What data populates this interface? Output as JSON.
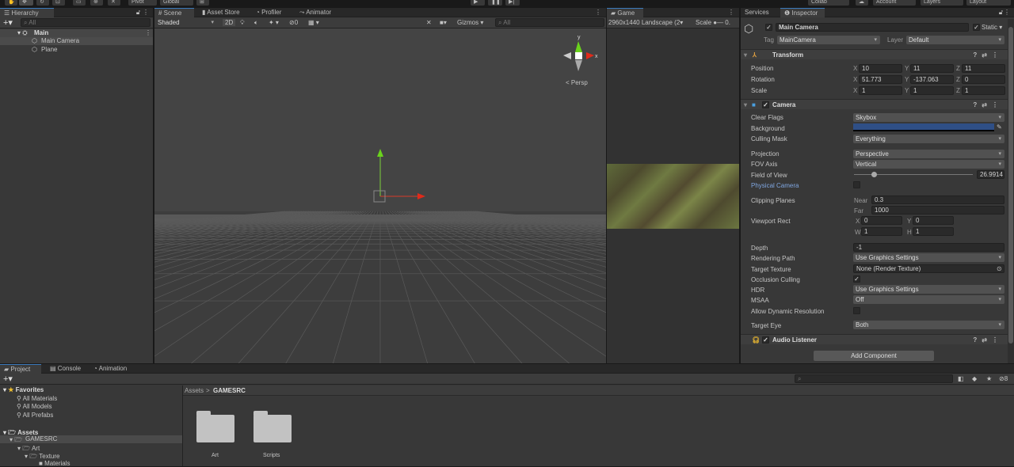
{
  "toolbar": {
    "pivot": "Pivot",
    "global": "Global",
    "collab": "Collab",
    "account": "Account",
    "layers": "Layers",
    "layout": "Layout"
  },
  "hierarchy": {
    "tab": "Hierarchy",
    "search_placeholder": "All",
    "scene": "Main",
    "items": [
      "Main Camera",
      "Plane"
    ]
  },
  "scene": {
    "tabs": [
      "Scene",
      "Asset Store",
      "Profiler",
      "Animator"
    ],
    "shading": "Shaded",
    "mode_2d": "2D",
    "hidden_count": "0",
    "gizmos": "Gizmos",
    "search_placeholder": "All",
    "persp": "< Persp"
  },
  "game": {
    "tab": "Game",
    "resolution": "2960x1440 Landscape (2",
    "scale_label": "Scale",
    "scale_value": "0."
  },
  "inspector": {
    "tabs": [
      "Services",
      "Inspector"
    ],
    "object_name": "Main Camera",
    "static_label": "Static",
    "tag_label": "Tag",
    "tag": "MainCamera",
    "layer_label": "Layer",
    "layer": "Default",
    "transform": {
      "title": "Transform",
      "rows": [
        {
          "label": "Position",
          "x": "10",
          "y": "11",
          "z": "11"
        },
        {
          "label": "Rotation",
          "x": "51.773",
          "y": "-137.063",
          "z": "0"
        },
        {
          "label": "Scale",
          "x": "1",
          "y": "1",
          "z": "1"
        }
      ]
    },
    "camera": {
      "title": "Camera",
      "clear_flags_label": "Clear Flags",
      "clear_flags": "Skybox",
      "background_label": "Background",
      "background_color": "#2f4f86",
      "culling_mask_label": "Culling Mask",
      "culling_mask": "Everything",
      "projection_label": "Projection",
      "projection": "Perspective",
      "fov_axis_label": "FOV Axis",
      "fov_axis": "Vertical",
      "fov_label": "Field of View",
      "fov": "26.9914",
      "physical_label": "Physical Camera",
      "clipping_label": "Clipping Planes",
      "near_label": "Near",
      "near": "0.3",
      "far_label": "Far",
      "far": "1000",
      "viewport_label": "Viewport Rect",
      "vx": "0",
      "vy": "0",
      "vw": "1",
      "vh": "1",
      "depth_label": "Depth",
      "depth": "-1",
      "rendering_path_label": "Rendering Path",
      "rendering_path": "Use Graphics Settings",
      "target_texture_label": "Target Texture",
      "target_texture": "None (Render Texture)",
      "occlusion_label": "Occlusion Culling",
      "hdr_label": "HDR",
      "hdr": "Use Graphics Settings",
      "msaa_label": "MSAA",
      "msaa": "Off",
      "dynres_label": "Allow Dynamic Resolution",
      "target_eye_label": "Target Eye",
      "target_eye": "Both"
    },
    "audio_listener": {
      "title": "Audio Listener"
    },
    "add_component": "Add Component"
  },
  "project": {
    "tabs": [
      "Project",
      "Console",
      "Animation"
    ],
    "favorites": "Favorites",
    "fav_items": [
      "All Materials",
      "All Models",
      "All Prefabs"
    ],
    "assets": "Assets",
    "tree": [
      "GAMESRC",
      "Art",
      "Texture",
      "Materials"
    ],
    "breadcrumb_root": "Assets",
    "breadcrumb_current": "GAMESRC",
    "folders": [
      "Art",
      "Scripts"
    ],
    "hidden_count": "8"
  }
}
